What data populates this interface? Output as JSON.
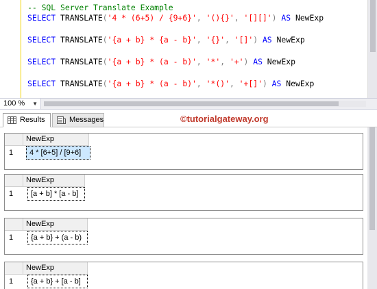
{
  "editor": {
    "lines": [
      {
        "tokens": [
          {
            "t": "-- SQL Server Translate Example",
            "c": "cm"
          }
        ]
      },
      {
        "tokens": [
          {
            "t": "SELECT",
            "c": "kw"
          },
          {
            "t": " ",
            "c": "id"
          },
          {
            "t": "TRANSLATE",
            "c": "id"
          },
          {
            "t": "(",
            "c": "op"
          },
          {
            "t": "'4 * (6+5) / {9+6}'",
            "c": "str"
          },
          {
            "t": ", ",
            "c": "op"
          },
          {
            "t": "'(){}'",
            "c": "str"
          },
          {
            "t": ", ",
            "c": "op"
          },
          {
            "t": "'[][]'",
            "c": "str"
          },
          {
            "t": ")",
            "c": "op"
          },
          {
            "t": " ",
            "c": "id"
          },
          {
            "t": "AS",
            "c": "kw"
          },
          {
            "t": " NewExp",
            "c": "id"
          }
        ]
      },
      {
        "tokens": [
          {
            "t": "SELECT",
            "c": "kw"
          },
          {
            "t": " ",
            "c": "id"
          },
          {
            "t": "TRANSLATE",
            "c": "id"
          },
          {
            "t": "(",
            "c": "op"
          },
          {
            "t": "'{a + b} * {a - b}'",
            "c": "str"
          },
          {
            "t": ", ",
            "c": "op"
          },
          {
            "t": "'{}'",
            "c": "str"
          },
          {
            "t": ", ",
            "c": "op"
          },
          {
            "t": "'[]'",
            "c": "str"
          },
          {
            "t": ")",
            "c": "op"
          },
          {
            "t": " ",
            "c": "id"
          },
          {
            "t": "AS",
            "c": "kw"
          },
          {
            "t": " NewExp",
            "c": "id"
          }
        ]
      },
      {
        "tokens": [
          {
            "t": "SELECT",
            "c": "kw"
          },
          {
            "t": " ",
            "c": "id"
          },
          {
            "t": "TRANSLATE",
            "c": "id"
          },
          {
            "t": "(",
            "c": "op"
          },
          {
            "t": "'{a + b} * (a - b)'",
            "c": "str"
          },
          {
            "t": ", ",
            "c": "op"
          },
          {
            "t": "'*'",
            "c": "str"
          },
          {
            "t": ", ",
            "c": "op"
          },
          {
            "t": "'+'",
            "c": "str"
          },
          {
            "t": ")",
            "c": "op"
          },
          {
            "t": " ",
            "c": "id"
          },
          {
            "t": "AS",
            "c": "kw"
          },
          {
            "t": " NewExp",
            "c": "id"
          }
        ]
      },
      {
        "tokens": [
          {
            "t": "SELECT",
            "c": "kw"
          },
          {
            "t": " ",
            "c": "id"
          },
          {
            "t": "TRANSLATE",
            "c": "id"
          },
          {
            "t": "(",
            "c": "op"
          },
          {
            "t": "'{a + b} * (a - b)'",
            "c": "str"
          },
          {
            "t": ", ",
            "c": "op"
          },
          {
            "t": "'*()'",
            "c": "str"
          },
          {
            "t": ", ",
            "c": "op"
          },
          {
            "t": "'+[]'",
            "c": "str"
          },
          {
            "t": ")",
            "c": "op"
          },
          {
            "t": " ",
            "c": "id"
          },
          {
            "t": "AS",
            "c": "kw"
          },
          {
            "t": " NewExp",
            "c": "id"
          }
        ]
      }
    ]
  },
  "zoom": {
    "value": "100 %"
  },
  "tabs": {
    "results": "Results",
    "messages": "Messages"
  },
  "watermark": "©tutorialgateway.org",
  "grids": [
    {
      "header": "NewExp",
      "row": "1",
      "value": "4 * [6+5] / [9+6]"
    },
    {
      "header": "NewExp",
      "row": "1",
      "value": "[a + b] * [a - b]"
    },
    {
      "header": "NewExp",
      "row": "1",
      "value": "{a + b} + (a - b)"
    },
    {
      "header": "NewExp",
      "row": "1",
      "value": "{a + b} + [a - b]"
    }
  ],
  "colors": {
    "keyword": "#0000ff",
    "string": "#ff0000",
    "comment": "#008000",
    "selection": "#cde8ff"
  }
}
